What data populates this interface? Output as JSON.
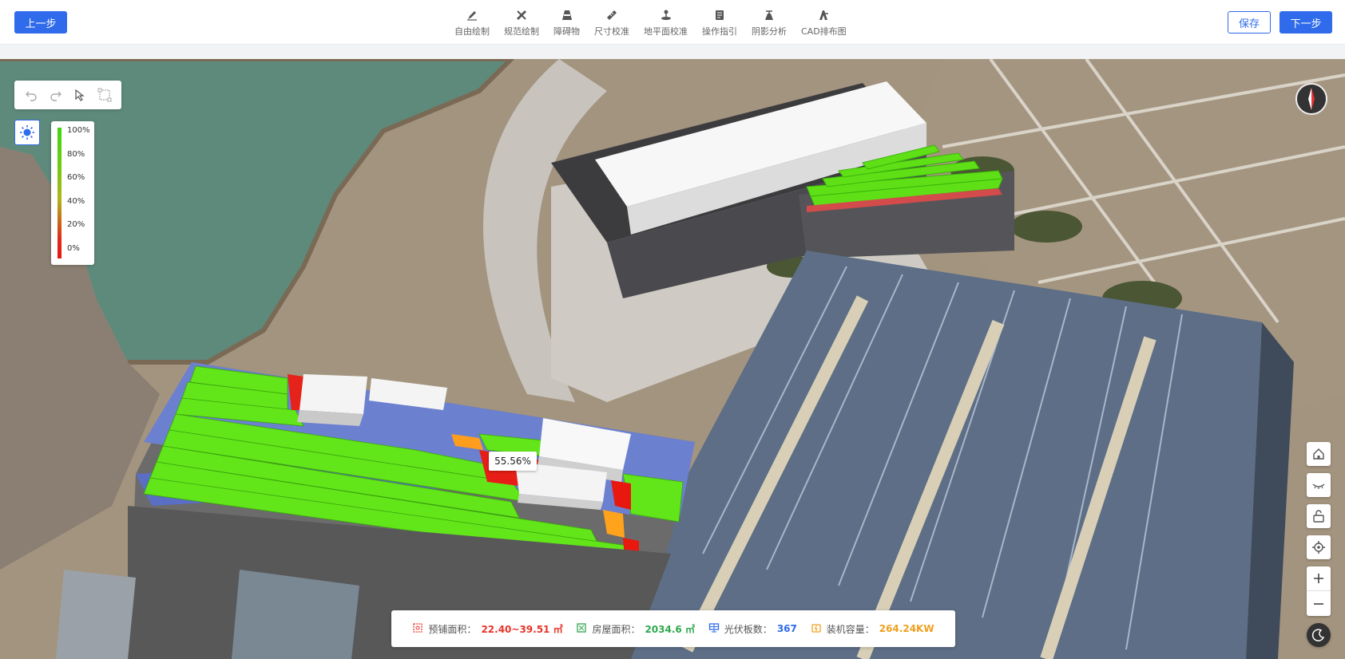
{
  "toolbar": {
    "prev_label": "上一步",
    "save_label": "保存",
    "next_label": "下一步",
    "tools": [
      {
        "label": "自由绘制",
        "icon": "pen-icon"
      },
      {
        "label": "规范绘制",
        "icon": "ruler-draw-icon"
      },
      {
        "label": "障碍物",
        "icon": "obstacle-icon"
      },
      {
        "label": "尺寸校准",
        "icon": "ruler-icon"
      },
      {
        "label": "地平面校准",
        "icon": "ground-level-icon"
      },
      {
        "label": "操作指引",
        "icon": "guide-icon"
      },
      {
        "label": "阴影分析",
        "icon": "shadow-analysis-icon"
      },
      {
        "label": "CAD排布图",
        "icon": "cad-layout-icon"
      }
    ]
  },
  "legend": {
    "labels": [
      "100%",
      "80%",
      "60%",
      "40%",
      "20%",
      "0%"
    ],
    "gradient_top": "#3ed514",
    "gradient_bottom": "#e8180f"
  },
  "tooltip": {
    "value": "55.56%"
  },
  "stats": {
    "area_label": "预铺面积：",
    "area_value": "22.40~39.51 ㎡",
    "area_color": "#e8352a",
    "roof_label": "房屋面积：",
    "roof_value": "2034.6 ㎡",
    "roof_color": "#2fa84f",
    "panel_label": "光伏板数：",
    "panel_value": "367",
    "panel_color": "#2f6bea",
    "capacity_label": "装机容量：",
    "capacity_value": "264.24KW",
    "capacity_color": "#f0a020"
  },
  "colors": {
    "accent": "#2f6bea"
  }
}
